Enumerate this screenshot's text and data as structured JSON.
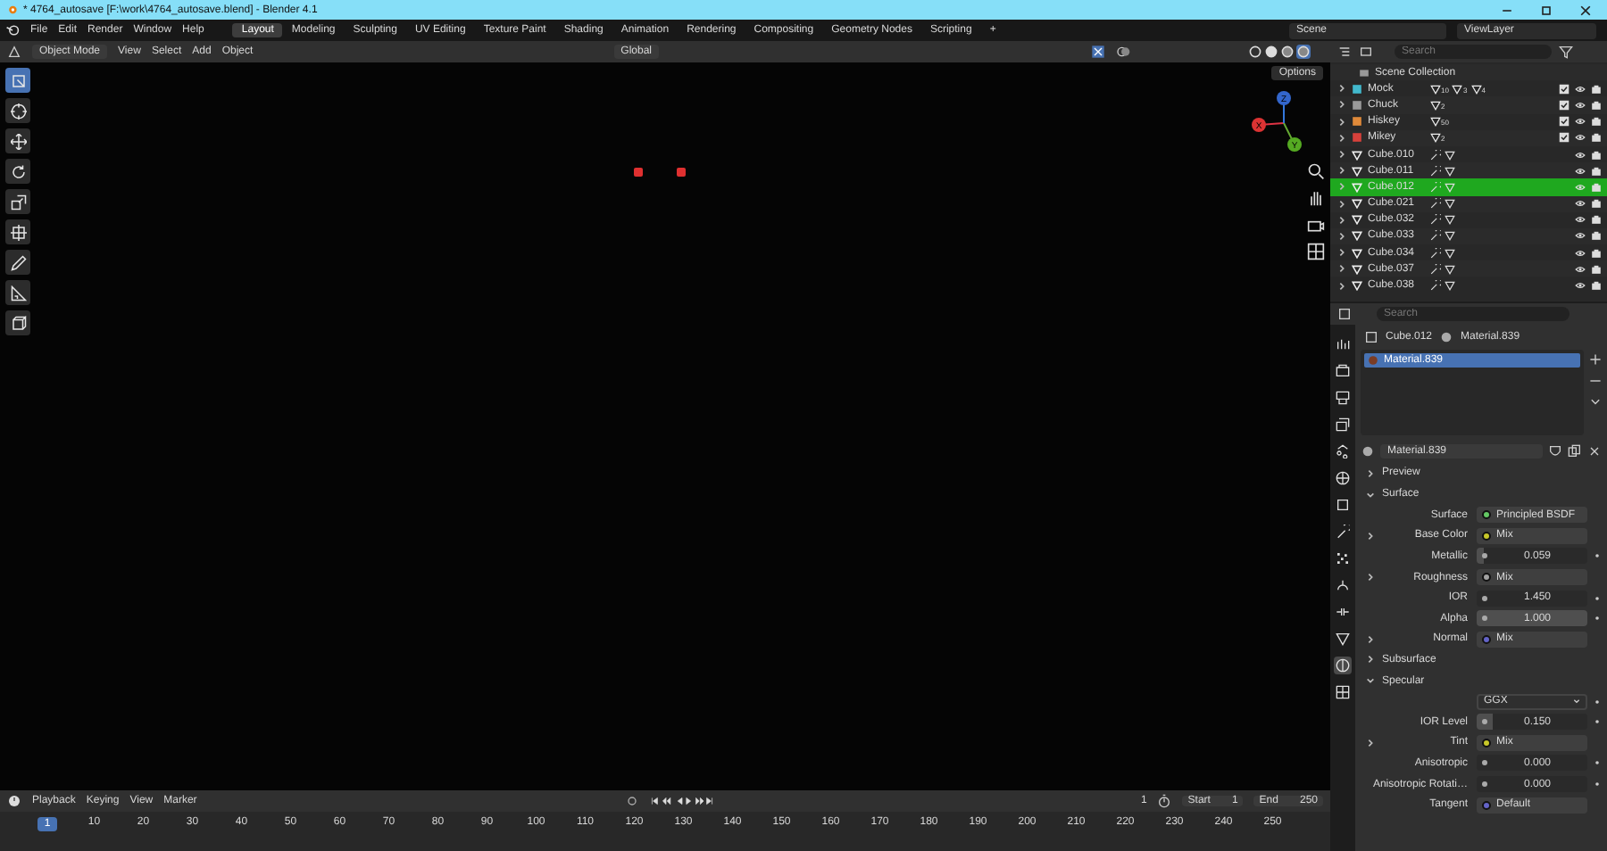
{
  "window": {
    "title": "* 4764_autosave [F:\\work\\4764_autosave.blend] - Blender 4.1"
  },
  "menu": [
    "File",
    "Edit",
    "Render",
    "Window",
    "Help"
  ],
  "workspaces": [
    {
      "label": "Layout",
      "selected": true
    },
    {
      "label": "Modeling",
      "selected": false
    },
    {
      "label": "Sculpting",
      "selected": false
    },
    {
      "label": "UV Editing",
      "selected": false
    },
    {
      "label": "Texture Paint",
      "selected": false
    },
    {
      "label": "Shading",
      "selected": false
    },
    {
      "label": "Animation",
      "selected": false
    },
    {
      "label": "Rendering",
      "selected": false
    },
    {
      "label": "Compositing",
      "selected": false
    },
    {
      "label": "Geometry Nodes",
      "selected": false
    },
    {
      "label": "Scripting",
      "selected": false
    }
  ],
  "add_workspace": "+",
  "scene": "Scene",
  "view_layer": "ViewLayer",
  "viewport": {
    "mode": "Object Mode",
    "menus": [
      "View",
      "Select",
      "Add",
      "Object"
    ],
    "orientation": "Global",
    "options": "Options",
    "gizmo_axes": [
      "X",
      "Y",
      "Z"
    ],
    "shading": [
      {
        "kind": "wire",
        "selected": false
      },
      {
        "kind": "solid",
        "selected": false
      },
      {
        "kind": "material",
        "selected": false
      },
      {
        "kind": "rendered",
        "selected": true
      }
    ],
    "tools": [
      {
        "kind": "select",
        "selected": true
      },
      {
        "kind": "cursor",
        "selected": false
      },
      {
        "kind": "move",
        "selected": false
      },
      {
        "kind": "rotate",
        "selected": false
      },
      {
        "kind": "scale",
        "selected": false
      },
      {
        "kind": "transform",
        "selected": false
      },
      {
        "kind": "annotate",
        "selected": false
      },
      {
        "kind": "measure",
        "selected": false
      },
      {
        "kind": "add-cube",
        "selected": false
      }
    ]
  },
  "outliner": {
    "search_placeholder": "Search",
    "root": {
      "name": "Scene Collection",
      "children": [
        {
          "kind": "collection",
          "name": "Mock",
          "color": "#42b8cc",
          "counts": [
            "10",
            "3",
            "4"
          ],
          "checked": true,
          "expanded": false,
          "selected": false
        },
        {
          "kind": "collection",
          "name": "Chuck",
          "color": "#9a9a9a",
          "counts": [
            "2"
          ],
          "checked": true,
          "expanded": false,
          "selected": false
        },
        {
          "kind": "collection",
          "name": "Hiskey",
          "color": "#e08a3a",
          "counts": [
            "50"
          ],
          "checked": true,
          "expanded": false,
          "selected": false
        },
        {
          "kind": "collection",
          "name": "Mikey",
          "color": "#d8413b",
          "counts": [
            "2"
          ],
          "checked": true,
          "expanded": false,
          "selected": false
        },
        {
          "kind": "mesh",
          "name": "Cube.010",
          "expanded": false,
          "selected": false
        },
        {
          "kind": "mesh",
          "name": "Cube.011",
          "expanded": false,
          "selected": false
        },
        {
          "kind": "mesh",
          "name": "Cube.012",
          "expanded": false,
          "selected": true
        },
        {
          "kind": "mesh",
          "name": "Cube.021",
          "expanded": false,
          "selected": false
        },
        {
          "kind": "mesh",
          "name": "Cube.032",
          "expanded": false,
          "selected": false
        },
        {
          "kind": "mesh",
          "name": "Cube.033",
          "expanded": false,
          "selected": false
        },
        {
          "kind": "mesh",
          "name": "Cube.034",
          "expanded": false,
          "selected": false
        },
        {
          "kind": "mesh",
          "name": "Cube.037",
          "expanded": false,
          "selected": false
        },
        {
          "kind": "mesh",
          "name": "Cube.038",
          "expanded": false,
          "selected": false
        }
      ]
    }
  },
  "properties": {
    "search_placeholder": "Search",
    "tabs": [
      {
        "kind": "tool",
        "selected": false
      },
      {
        "kind": "render",
        "selected": false
      },
      {
        "kind": "output",
        "selected": false
      },
      {
        "kind": "view-layer",
        "selected": false
      },
      {
        "kind": "scene",
        "selected": false
      },
      {
        "kind": "world",
        "selected": false
      },
      {
        "kind": "object",
        "selected": false
      },
      {
        "kind": "modifier",
        "selected": false
      },
      {
        "kind": "particles",
        "selected": false
      },
      {
        "kind": "physics",
        "selected": false
      },
      {
        "kind": "constraint",
        "selected": false
      },
      {
        "kind": "data",
        "selected": false
      },
      {
        "kind": "material",
        "selected": true
      },
      {
        "kind": "texture",
        "selected": false
      }
    ],
    "object": "Cube.012",
    "material": "Material.839",
    "slots": [
      {
        "name": "Material.839",
        "selected": true
      }
    ],
    "datablock": "Material.839",
    "panels": [
      {
        "label": "Preview",
        "expanded": false
      },
      {
        "label": "Surface",
        "expanded": true,
        "rows": [
          {
            "kind": "socket",
            "label": "Surface",
            "value": "Principled BSDF",
            "color": "#63c763",
            "expandable": false
          },
          {
            "kind": "socket",
            "label": "Base Color",
            "value": "Mix",
            "color": "#c7c729",
            "expandable": true
          },
          {
            "kind": "slider",
            "label": "Metallic",
            "value": "0.059",
            "level": 0.059
          },
          {
            "kind": "socket",
            "label": "Roughness",
            "value": "Mix",
            "color": "#a1a1a1",
            "expandable": true
          },
          {
            "kind": "number",
            "label": "IOR",
            "value": "1.450"
          },
          {
            "kind": "slider",
            "label": "Alpha",
            "value": "1.000",
            "level": 1
          },
          {
            "kind": "socket",
            "label": "Normal",
            "value": "Mix",
            "color": "#6363c7",
            "expandable": true
          },
          {
            "kind": "section",
            "label": "Subsurface",
            "expanded": false
          },
          {
            "kind": "section",
            "label": "Specular",
            "expanded": true
          },
          {
            "kind": "dropdown",
            "value": "GGX"
          },
          {
            "kind": "slider",
            "label": "IOR Level",
            "value": "0.150",
            "level": 0.15
          },
          {
            "kind": "socket",
            "label": "Tint",
            "value": "Mix",
            "color": "#c7c729",
            "expandable": true
          },
          {
            "kind": "slider",
            "label": "Anisotropic",
            "value": "0.000",
            "level": 0
          },
          {
            "kind": "slider",
            "label": "Anisotropic Rotati…",
            "value": "0.000",
            "level": 0
          },
          {
            "kind": "socket",
            "label": "Tangent",
            "value": "Default",
            "color": "#6363c7",
            "expandable": false
          }
        ]
      }
    ]
  },
  "timeline": {
    "menus": [
      "Playback",
      "Keying",
      "View",
      "Marker"
    ],
    "current_frame": "1",
    "start_label": "Start",
    "start": "1",
    "end_label": "End",
    "end": "250",
    "ruler": [
      {
        "label": "1",
        "selected": true
      },
      {
        "label": "10",
        "selected": false
      },
      {
        "label": "20",
        "selected": false
      },
      {
        "label": "30",
        "selected": false
      },
      {
        "label": "40",
        "selected": false
      },
      {
        "label": "50",
        "selected": false
      },
      {
        "label": "60",
        "selected": false
      },
      {
        "label": "70",
        "selected": false
      },
      {
        "label": "80",
        "selected": false
      },
      {
        "label": "90",
        "selected": false
      },
      {
        "label": "100",
        "selected": false
      },
      {
        "label": "110",
        "selected": false
      },
      {
        "label": "120",
        "selected": false
      },
      {
        "label": "130",
        "selected": false
      },
      {
        "label": "140",
        "selected": false
      },
      {
        "label": "150",
        "selected": false
      },
      {
        "label": "160",
        "selected": false
      },
      {
        "label": "170",
        "selected": false
      },
      {
        "label": "180",
        "selected": false
      },
      {
        "label": "190",
        "selected": false
      },
      {
        "label": "200",
        "selected": false
      },
      {
        "label": "210",
        "selected": false
      },
      {
        "label": "220",
        "selected": false
      },
      {
        "label": "230",
        "selected": false
      },
      {
        "label": "240",
        "selected": false
      },
      {
        "label": "250",
        "selected": false
      }
    ]
  }
}
